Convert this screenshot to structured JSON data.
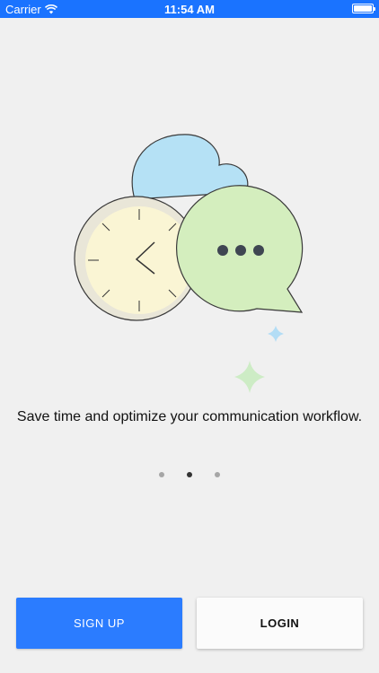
{
  "status_bar": {
    "carrier": "Carrier",
    "time": "11:54 AM",
    "battery_level": 1.0
  },
  "illustration": {
    "icons": [
      "cloud-icon",
      "clock-icon",
      "chat-bubble-icon",
      "sparkle-icon"
    ],
    "colors": {
      "cloud": "#b5e1f5",
      "clock": "#faf5d4",
      "bubble": "#d4eebe",
      "sparkle_blue": "#b3ddf5",
      "sparkle_green": "#cdecc5"
    }
  },
  "onboarding": {
    "tagline": "Save time and optimize your communication workflow.",
    "pages": 3,
    "current_page": 2
  },
  "actions": {
    "signup_label": "SIGN UP",
    "login_label": "LOGIN"
  },
  "colors": {
    "accent": "#2b7cff",
    "status_bar": "#1a73ff"
  }
}
